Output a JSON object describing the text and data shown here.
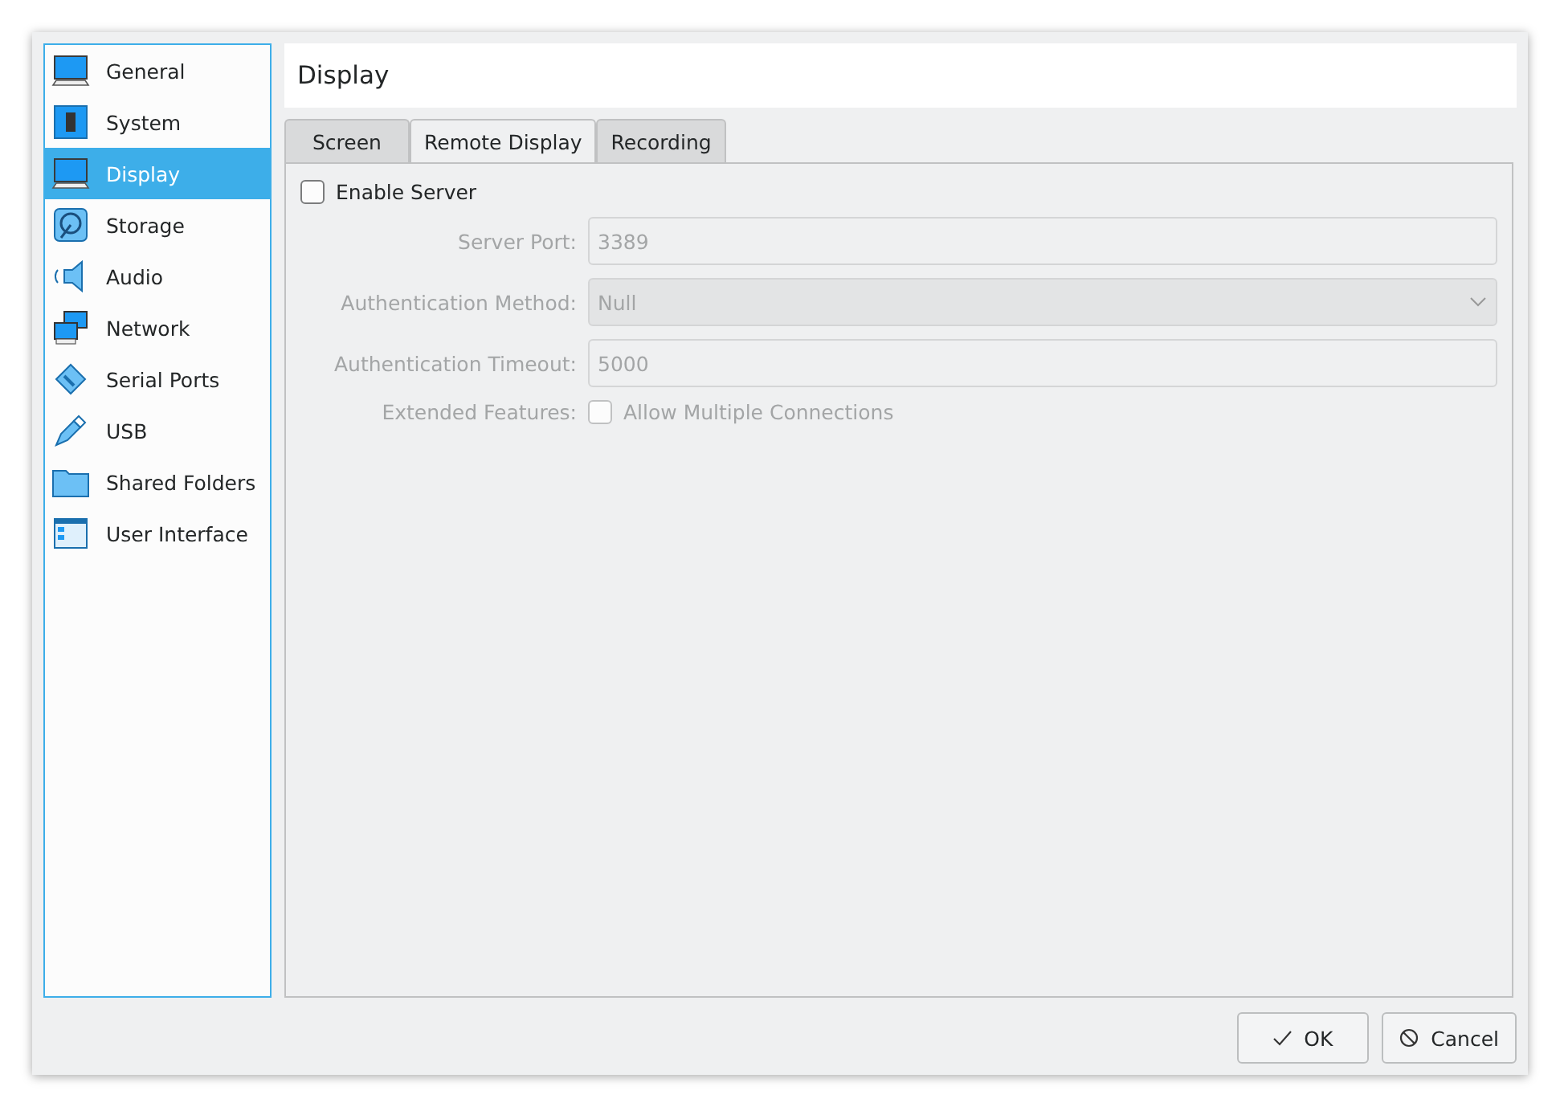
{
  "sidebar": {
    "items": [
      {
        "label": "General",
        "kind": "general",
        "selected": false
      },
      {
        "label": "System",
        "kind": "system",
        "selected": false
      },
      {
        "label": "Display",
        "kind": "display",
        "selected": true
      },
      {
        "label": "Storage",
        "kind": "storage",
        "selected": false
      },
      {
        "label": "Audio",
        "kind": "audio",
        "selected": false
      },
      {
        "label": "Network",
        "kind": "network",
        "selected": false
      },
      {
        "label": "Serial Ports",
        "kind": "serial",
        "selected": false
      },
      {
        "label": "USB",
        "kind": "usb",
        "selected": false
      },
      {
        "label": "Shared Folders",
        "kind": "folder",
        "selected": false
      },
      {
        "label": "User Interface",
        "kind": "ui",
        "selected": false
      }
    ]
  },
  "page_title": "Display",
  "tabs": [
    {
      "label": "Screen",
      "selected": false
    },
    {
      "label": "Remote Display",
      "selected": true
    },
    {
      "label": "Recording",
      "selected": false
    }
  ],
  "enable_server": {
    "label": "Enable Server",
    "checked": false
  },
  "fields": [
    {
      "kind": "text",
      "label": "Server Port:",
      "value": "3389",
      "disabled": true
    },
    {
      "kind": "combo",
      "label": "Authentication Method:",
      "value": "Null",
      "disabled": true
    },
    {
      "kind": "text",
      "label": "Authentication Timeout:",
      "value": "5000",
      "disabled": true
    },
    {
      "kind": "checkbox",
      "label": "Extended Features:",
      "value": "Allow Multiple Connections",
      "checked": false,
      "disabled": true
    }
  ],
  "buttons": [
    {
      "kind": "ok",
      "label": "OK"
    },
    {
      "kind": "cancel",
      "label": "Cancel"
    }
  ]
}
